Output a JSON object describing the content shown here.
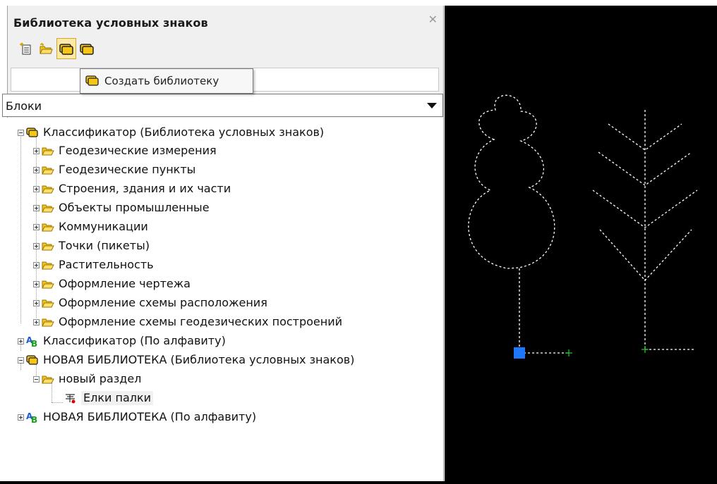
{
  "panel": {
    "title": "Библиотека условных знаков",
    "close_icon": "close-icon",
    "toolbar": [
      {
        "icon": "new-section-icon",
        "tooltip": ""
      },
      {
        "icon": "open-folder-icon",
        "tooltip": ""
      },
      {
        "icon": "create-library-icon",
        "tooltip": "Создать библиотеку"
      },
      {
        "icon": "library-icon",
        "tooltip": ""
      }
    ],
    "tooltip_text": "Создать библиотеку",
    "search_value": "",
    "dropdown_value": "Блоки"
  },
  "tree": [
    {
      "label": "Классификатор (Библиотека условных знаков)",
      "icon": "library-icon",
      "expanded": true,
      "level": 0
    },
    {
      "label": "Геодезические измерения",
      "icon": "folder-icon",
      "expanded": false,
      "level": 1
    },
    {
      "label": "Геодезические пункты",
      "icon": "folder-icon",
      "expanded": false,
      "level": 1
    },
    {
      "label": "Строения, здания и их части",
      "icon": "folder-icon",
      "expanded": false,
      "level": 1
    },
    {
      "label": "Объекты промышленные",
      "icon": "folder-icon",
      "expanded": false,
      "level": 1
    },
    {
      "label": "Коммуникации",
      "icon": "folder-icon",
      "expanded": false,
      "level": 1
    },
    {
      "label": "Точки (пикеты)",
      "icon": "folder-icon",
      "expanded": false,
      "level": 1
    },
    {
      "label": "Растительность",
      "icon": "folder-icon",
      "expanded": false,
      "level": 1
    },
    {
      "label": "Оформление чертежа",
      "icon": "folder-icon",
      "expanded": false,
      "level": 1
    },
    {
      "label": "Оформление схемы расположения",
      "icon": "folder-icon",
      "expanded": false,
      "level": 1
    },
    {
      "label": "Оформление схемы геодезических построений",
      "icon": "folder-icon",
      "expanded": false,
      "level": 1
    },
    {
      "label": "Классификатор (По алфавиту)",
      "icon": "alphabet-icon",
      "expanded": false,
      "level": 0
    },
    {
      "label": "НОВАЯ БИБЛИОТЕКА (Библиотека условных знаков)",
      "icon": "library-icon",
      "expanded": true,
      "level": 0
    },
    {
      "label": "новый раздел",
      "icon": "folder-icon",
      "expanded": true,
      "level": 1
    },
    {
      "label": "Елки палки",
      "icon": "block-icon",
      "expanded": null,
      "level": 2,
      "selected": true
    },
    {
      "label": "НОВАЯ БИБЛИОТЕКА (По алфавиту)",
      "icon": "alphabet-icon",
      "expanded": false,
      "level": 0
    }
  ],
  "colors": {
    "canvas": "#000000",
    "dashed_line": "#ffffff",
    "grip": "#1e78ff",
    "cross": "#22cc22",
    "folder": "#f5c518",
    "library": "#e0a800"
  }
}
